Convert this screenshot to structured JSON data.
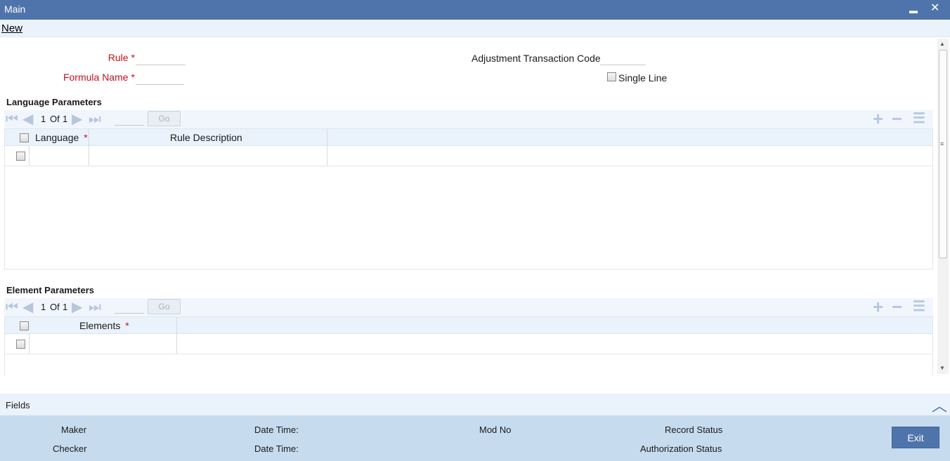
{
  "window": {
    "title": "Main",
    "minimize_glyph": "▬",
    "close_glyph": "✕"
  },
  "menu": {
    "new_label": "New"
  },
  "form": {
    "rule_label": "Rule",
    "formula_name_label": "Formula Name",
    "required_marker": "*",
    "adjustment_code_label": "Adjustment Transaction Code",
    "single_line_label": "Single Line",
    "rule_value": "",
    "formula_name_value": "",
    "adjustment_code_value": "",
    "single_line_checked": false
  },
  "language_params": {
    "title": "Language Parameters",
    "pager": {
      "current": "1",
      "of_label": "Of",
      "total": "1",
      "go_label": "Go"
    },
    "columns": [
      "Language",
      "Rule Description"
    ],
    "language_required": "*",
    "rows": [
      {
        "language": "",
        "rule_description": ""
      }
    ]
  },
  "element_params": {
    "title": "Element Parameters",
    "pager": {
      "current": "1",
      "of_label": "Of",
      "total": "1",
      "go_label": "Go"
    },
    "columns": [
      "Elements"
    ],
    "elements_required": "*",
    "rows": [
      {
        "elements": ""
      }
    ]
  },
  "fields_bar": {
    "label": "Fields"
  },
  "footer": {
    "maker_label": "Maker",
    "checker_label": "Checker",
    "maker_datetime_label": "Date Time:",
    "checker_datetime_label": "Date Time:",
    "mod_no_label": "Mod No",
    "record_status_label": "Record Status",
    "authorization_status_label": "Authorization Status",
    "exit_label": "Exit"
  },
  "icons": {
    "first": "first-page-icon",
    "prev": "prev-page-icon",
    "next": "next-page-icon",
    "last": "last-page-icon",
    "add": "add-row-icon",
    "delete": "delete-row-icon",
    "view": "single-view-icon",
    "collapse": "chevron-up-icon"
  },
  "colors": {
    "titlebar": "#4f74ac",
    "required": "#c0121e",
    "footer": "#c6dbee",
    "exit_button": "#4f74ac",
    "pager_icon": "#b7c6dc"
  }
}
